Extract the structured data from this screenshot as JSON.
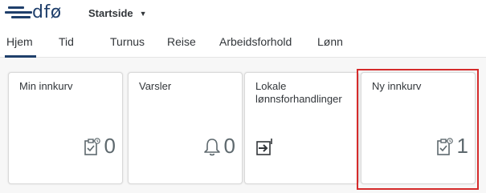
{
  "app": {
    "logo_text": "dfø",
    "home_menu_label": "Startside",
    "brand_color": "#1f3f6b",
    "highlight_color": "#d52b2b"
  },
  "tabs": [
    {
      "label": "Hjem",
      "selected": true
    },
    {
      "label": "Tid",
      "selected": false
    },
    {
      "label": "Turnus",
      "selected": false
    },
    {
      "label": "Reise",
      "selected": false
    },
    {
      "label": "Arbeidsforhold",
      "selected": false
    },
    {
      "label": "Lønn",
      "selected": false
    }
  ],
  "tiles": [
    {
      "title": "Min innkurv",
      "icon": "clipboard-check-icon",
      "count": "0"
    },
    {
      "title": "Varsler",
      "icon": "bell-icon",
      "count": "0"
    },
    {
      "title": "Lokale lønnsforhandlinger",
      "icon": "arrow-into-box-icon",
      "count": ""
    },
    {
      "title": "Ny innkurv",
      "icon": "clipboard-check-icon",
      "count": "1"
    }
  ]
}
